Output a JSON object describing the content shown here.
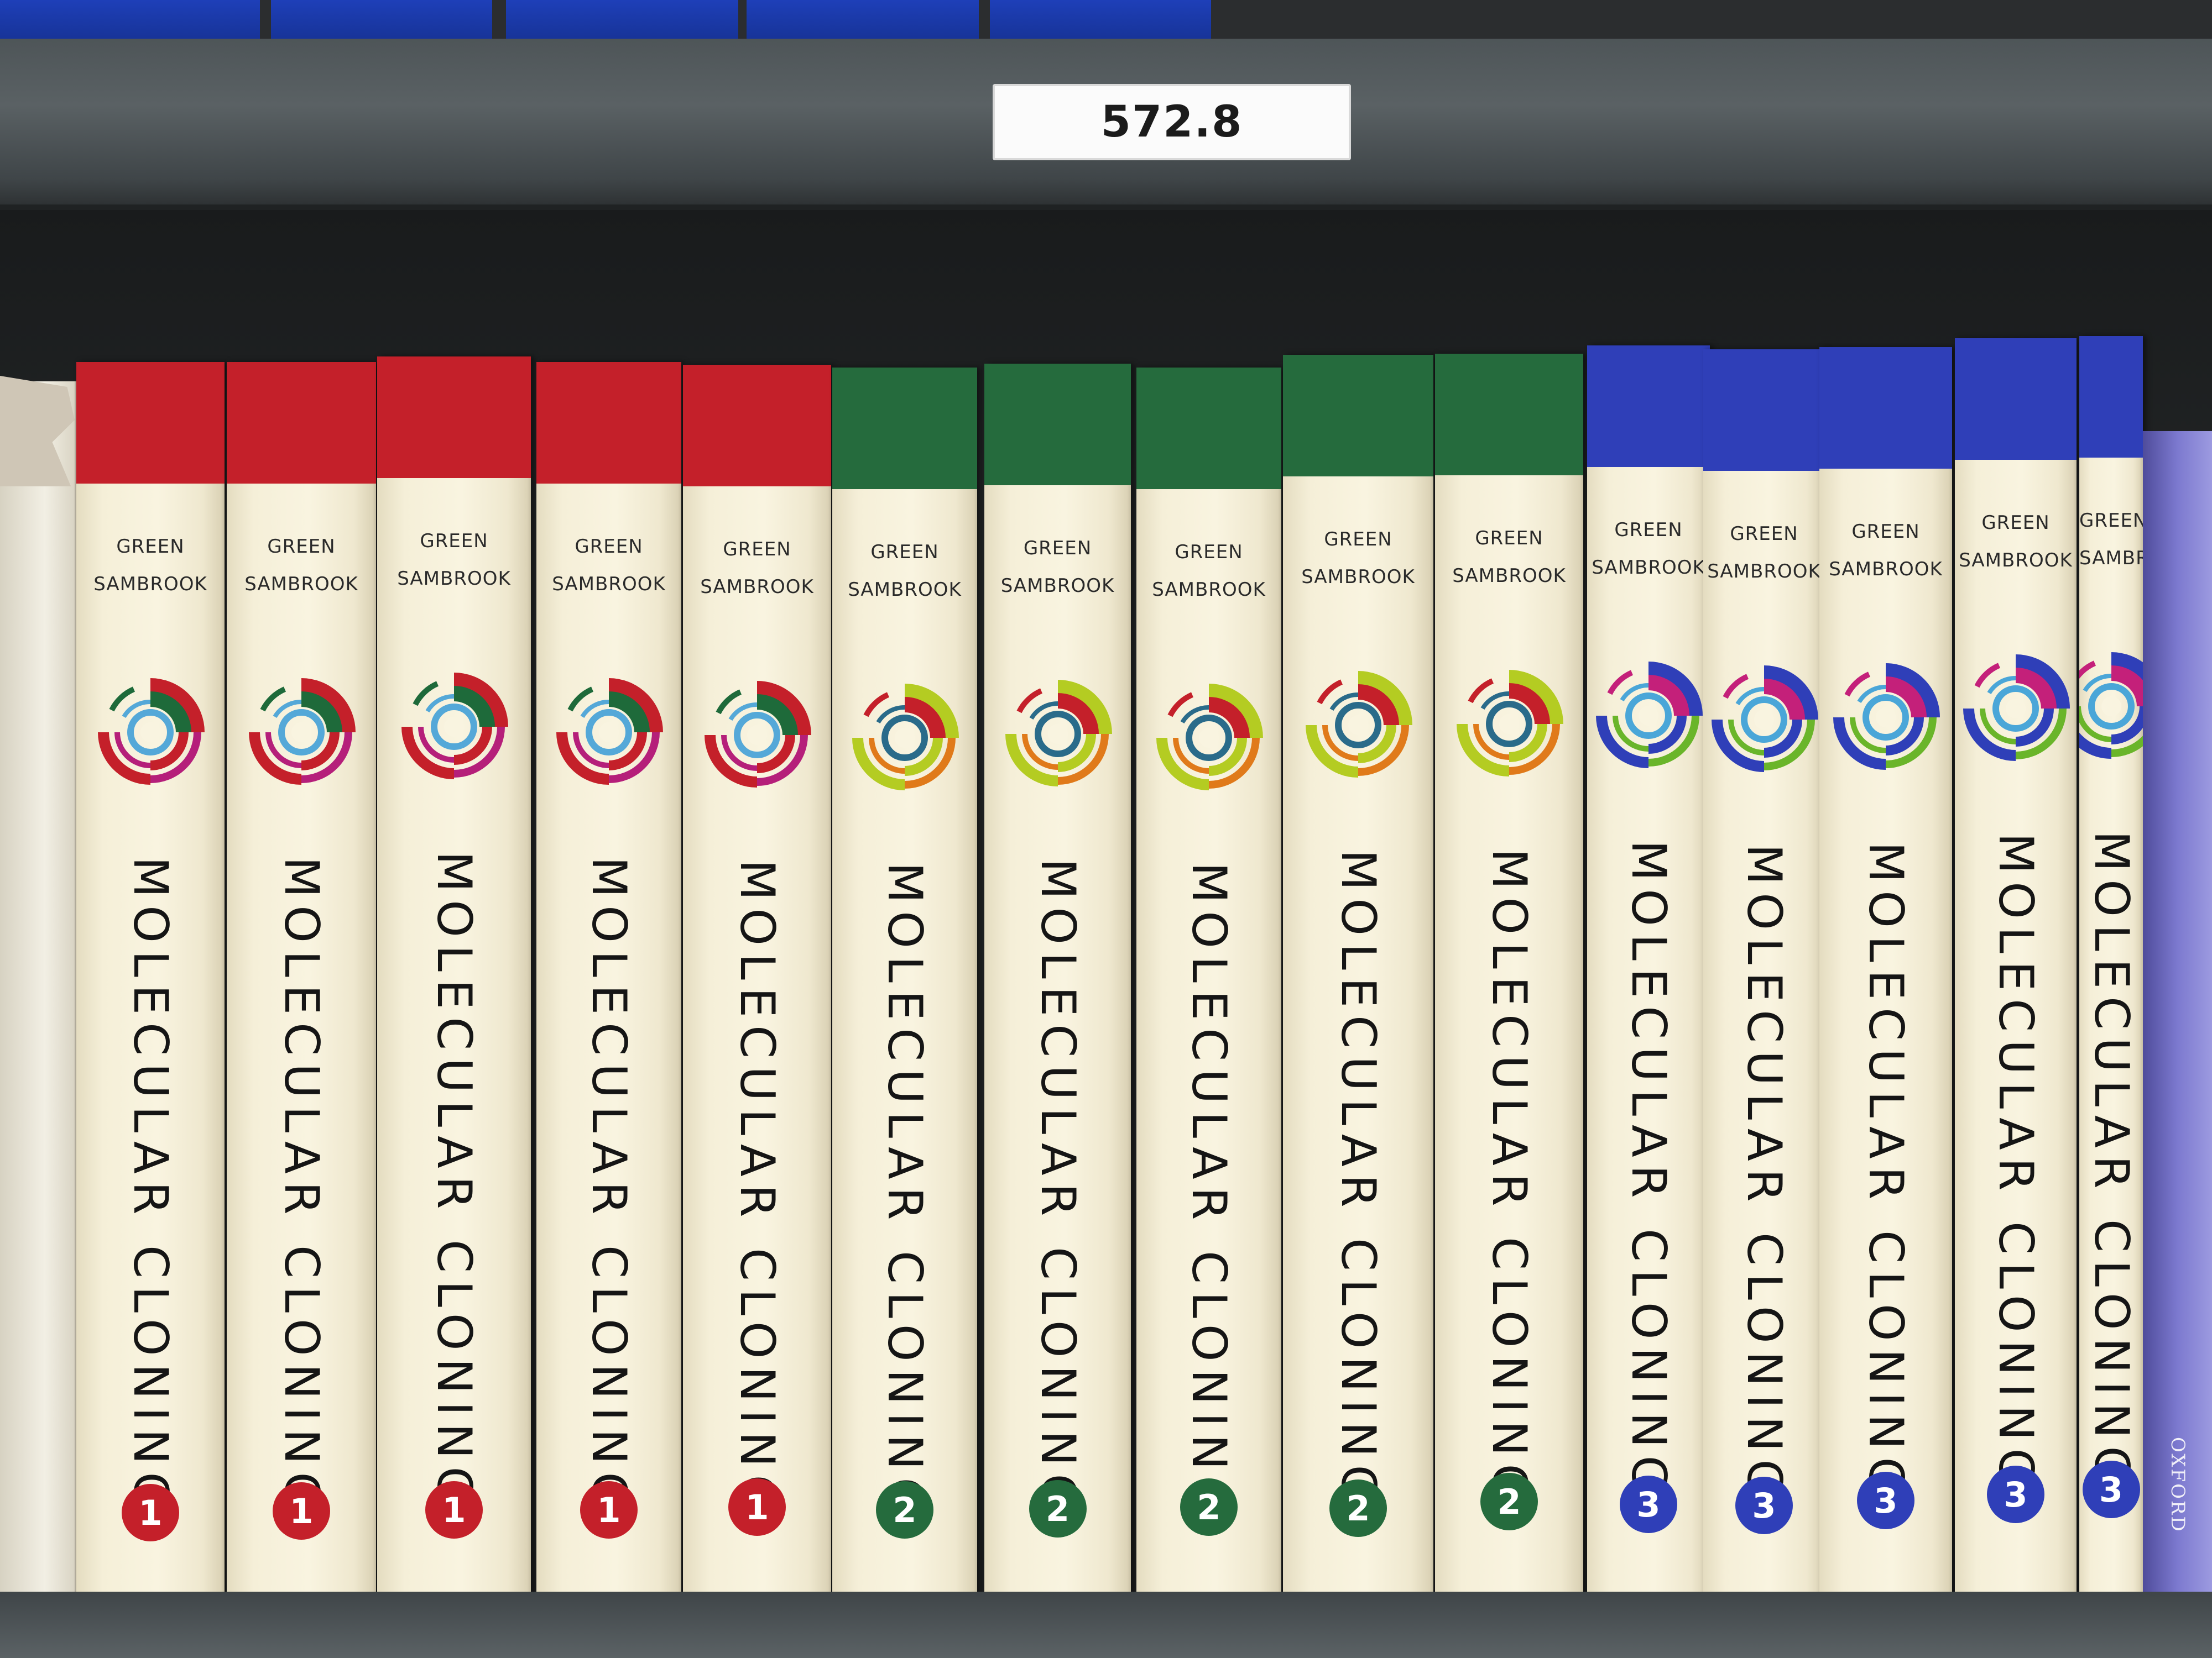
{
  "shelf_label": "572.8",
  "colors": {
    "vol1": "#c4202a",
    "vol2": "#256b3d",
    "vol3": "#2f3fb8",
    "vol1_accents": [
      "#c4202a",
      "#b51f7a",
      "#1e6a3a",
      "#54a8d8"
    ],
    "vol2_accents": [
      "#b4cc22",
      "#e07a1a",
      "#c4202a",
      "#2a6b8a"
    ],
    "vol3_accents": [
      "#2f3fb8",
      "#6ab52a",
      "#c4207a",
      "#4aa6d8"
    ]
  },
  "neighbors": {
    "right_publisher": "OXFORD"
  },
  "books": [
    {
      "author1": "GREEN",
      "author2": "SAMBROOK",
      "title": "MOLECULAR CLONING",
      "volume": "1",
      "series": "vol1"
    },
    {
      "author1": "GREEN",
      "author2": "SAMBROOK",
      "title": "MOLECULAR CLONING",
      "volume": "1",
      "series": "vol1"
    },
    {
      "author1": "GREEN",
      "author2": "SAMBROOK",
      "title": "MOLECULAR CLONING",
      "volume": "1",
      "series": "vol1"
    },
    {
      "author1": "GREEN",
      "author2": "SAMBROOK",
      "title": "MOLECULAR CLONING",
      "volume": "1",
      "series": "vol1"
    },
    {
      "author1": "GREEN",
      "author2": "SAMBROOK",
      "title": "MOLECULAR CLONING",
      "volume": "1",
      "series": "vol1"
    },
    {
      "author1": "GREEN",
      "author2": "SAMBROOK",
      "title": "MOLECULAR CLONING",
      "volume": "2",
      "series": "vol2"
    },
    {
      "author1": "GREEN",
      "author2": "SAMBROOK",
      "title": "MOLECULAR CLONING",
      "volume": "2",
      "series": "vol2"
    },
    {
      "author1": "GREEN",
      "author2": "SAMBROOK",
      "title": "MOLECULAR CLONING",
      "volume": "2",
      "series": "vol2"
    },
    {
      "author1": "GREEN",
      "author2": "SAMBROOK",
      "title": "MOLECULAR CLONING",
      "volume": "2",
      "series": "vol2"
    },
    {
      "author1": "GREEN",
      "author2": "SAMBROOK",
      "title": "MOLECULAR CLONING",
      "volume": "2",
      "series": "vol2"
    },
    {
      "author1": "GREEN",
      "author2": "SAMBROOK",
      "title": "MOLECULAR CLONING",
      "volume": "3",
      "series": "vol3"
    },
    {
      "author1": "GREEN",
      "author2": "SAMBROOK",
      "title": "MOLECULAR CLONING",
      "volume": "3",
      "series": "vol3"
    },
    {
      "author1": "GREEN",
      "author2": "SAMBROOK",
      "title": "MOLECULAR CLONING",
      "volume": "3",
      "series": "vol3"
    },
    {
      "author1": "GREEN",
      "author2": "SAMBROOK",
      "title": "MOLECULAR CLONING",
      "volume": "3",
      "series": "vol3"
    },
    {
      "author1": "GREEN",
      "author2": "SAMBROOK",
      "title": "MOLECULAR CLONING",
      "volume": "3",
      "series": "vol3"
    }
  ]
}
